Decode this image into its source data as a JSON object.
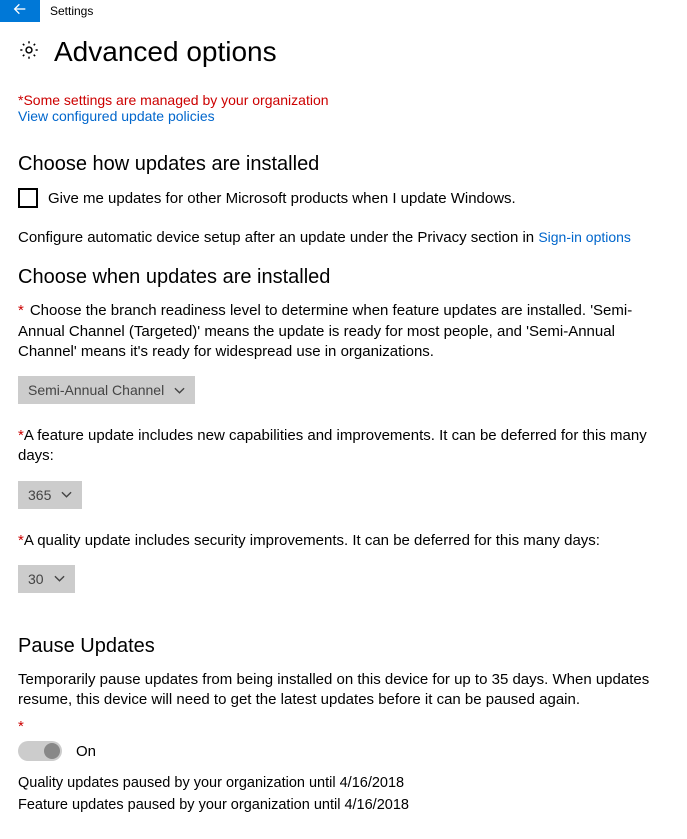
{
  "titlebar": {
    "app_name": "Settings"
  },
  "page": {
    "title": "Advanced options"
  },
  "notices": {
    "managed": "*Some settings are managed by your organization",
    "view_policies": "View configured update policies"
  },
  "sections": {
    "how_installed": {
      "title": "Choose how updates are installed",
      "checkbox_label": "Give me updates for other Microsoft products when I update Windows.",
      "configure_prefix": "Configure automatic device setup after an update under the Privacy section in ",
      "signin_link": "Sign-in options"
    },
    "when_installed": {
      "title": "Choose when updates are installed",
      "branch_text": "Choose the branch readiness level to determine when feature updates are installed. 'Semi-Annual Channel (Targeted)' means the update is ready for most people, and 'Semi-Annual Channel' means it's ready for widespread use in organizations.",
      "branch_value": "Semi-Annual Channel",
      "feature_text": "A feature update includes new capabilities and improvements. It can be deferred for this many days:",
      "feature_value": "365",
      "quality_text": "A quality update includes security improvements. It can be deferred for this many days:",
      "quality_value": "30"
    },
    "pause": {
      "title": "Pause Updates",
      "description": "Temporarily pause updates from being installed on this device for up to 35 days. When updates resume, this device will need to get the latest updates before it can be paused again.",
      "toggle_label": "On",
      "quality_paused": "Quality updates paused by your organization until  4/16/2018",
      "feature_paused": "Feature updates paused by your organization until  4/16/2018"
    }
  }
}
